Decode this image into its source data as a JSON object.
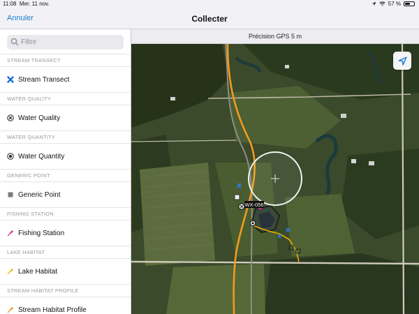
{
  "status_bar": {
    "time": "11:08",
    "date": "Mer. 11 nov.",
    "battery": "57 %",
    "battery_level": 0.57
  },
  "nav": {
    "cancel_label": "Annuler",
    "title": "Collecter"
  },
  "search": {
    "placeholder": "Filtre",
    "value": ""
  },
  "groups": [
    {
      "header": "STREAM TRANSECT",
      "item": "Stream Transect",
      "symbol": "blue-x-icon",
      "color": "#1a6fd8"
    },
    {
      "header": "WATER QUALITY",
      "item": "Water Quality",
      "symbol": "circled-x-icon",
      "color": "#222222"
    },
    {
      "header": "WATER QUANTITY",
      "item": "Water Quantity",
      "symbol": "target-dot-icon",
      "color": "#222222"
    },
    {
      "header": "GENERIC POINT",
      "item": "Generic Point",
      "symbol": "gray-square-icon",
      "color": "#7a7a7a"
    },
    {
      "header": "FISHING STATION",
      "item": "Fishing Station",
      "symbol": "magenta-pin-icon",
      "color": "#e0208c"
    },
    {
      "header": "LAKE HABITAT",
      "item": "Lake Habitat",
      "symbol": "yellow-pin-icon",
      "color": "#e8b000"
    },
    {
      "header": "STREAM HABITAT PROFILE",
      "item": "Stream Habitat Profile",
      "symbol": "orange-pin-icon",
      "color": "#f08a10"
    }
  ],
  "gps": {
    "label": "Précision GPS 5 m"
  },
  "map": {
    "feature_label": "WX-056",
    "accent_orange": "#f39a1e",
    "locate_icon": "location-arrow-icon"
  }
}
